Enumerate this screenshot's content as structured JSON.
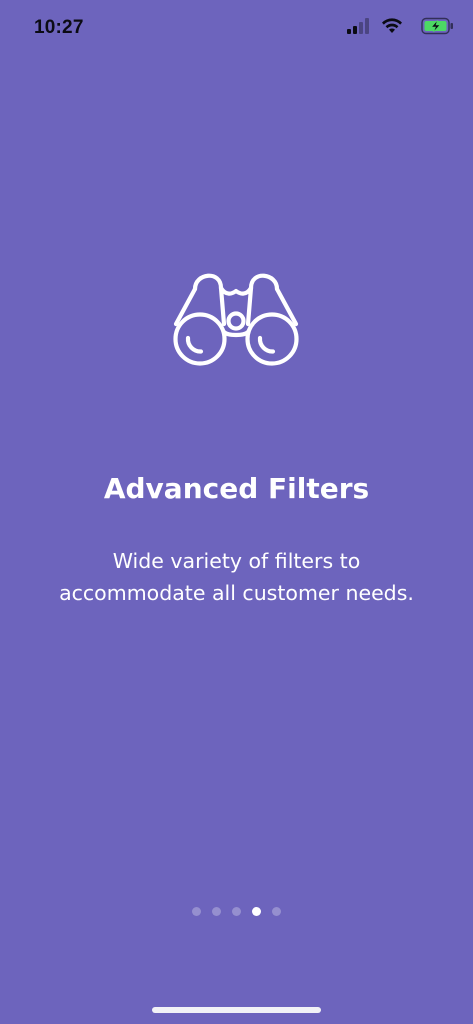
{
  "status_bar": {
    "time": "10:27",
    "icons": [
      "cellular-signal-icon",
      "wifi-icon",
      "battery-charging-icon"
    ]
  },
  "onboarding": {
    "icon": "binoculars-icon",
    "title": "Advanced Filters",
    "description": "Wide variety of filters to accommodate all customer needs."
  },
  "pagination": {
    "total_pages": 5,
    "current_page": 4
  },
  "colors": {
    "background": "#6d64bd",
    "text": "#ffffff",
    "dot_inactive": "rgba(255,255,255,0.28)",
    "dot_active": "#ffffff",
    "battery_fill": "#4cd964"
  }
}
